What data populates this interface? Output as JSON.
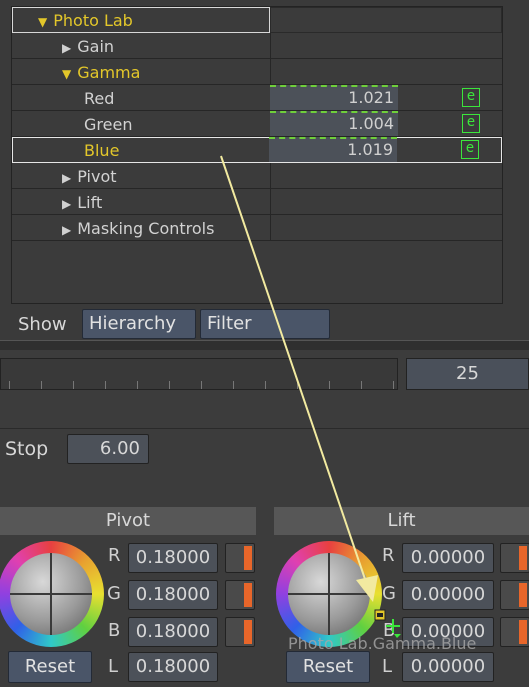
{
  "tree": {
    "rows": [
      {
        "label": "Photo Lab",
        "indent": 0,
        "expanded": true,
        "state": "header"
      },
      {
        "label": "Gain",
        "indent": 1,
        "expanded": false,
        "state": "normal"
      },
      {
        "label": "Gamma",
        "indent": 1,
        "expanded": true,
        "state": "active"
      },
      {
        "label": "Red",
        "indent": 2,
        "value": "1.021",
        "expr_icon": "e"
      },
      {
        "label": "Green",
        "indent": 2,
        "value": "1.004",
        "expr_icon": "e"
      },
      {
        "label": "Blue",
        "indent": 2,
        "value": "1.019",
        "expr_icon": "e",
        "selected": true
      },
      {
        "label": "Pivot",
        "indent": 1,
        "expanded": false
      },
      {
        "label": "Lift",
        "indent": 1,
        "expanded": false
      },
      {
        "label": "Masking Controls",
        "indent": 1,
        "expanded": false
      }
    ]
  },
  "show": {
    "label": "Show",
    "hierarchy": "Hierarchy",
    "filter": "Filter"
  },
  "timeline": {
    "frame": "25"
  },
  "stop": {
    "label": "Stop",
    "value": "6.00"
  },
  "pivot": {
    "title": "Pivot",
    "r_label": "R",
    "r": "0.18000",
    "g_label": "G",
    "g": "0.18000",
    "b_label": "B",
    "b": "0.18000",
    "l_label": "L",
    "l": "0.18000",
    "reset": "Reset"
  },
  "lift": {
    "title": "Lift",
    "r_label": "R",
    "r": "0.00000",
    "g_label": "G",
    "g": "0.00000",
    "b_label": "B",
    "b": "0.00000",
    "l_label": "L",
    "l": "0.00000",
    "reset": "Reset"
  },
  "drag_tooltip": "Photo Lab.Gamma.Blue",
  "colors": {
    "accent_yellow": "#e3c72a",
    "expr_green": "#3be63b",
    "swatch_orange": "#e8662a",
    "button_blue": "#4a5568"
  },
  "icons": {
    "expand": "triangle-right-icon",
    "collapse": "triangle-down-icon",
    "expression": "expression-e-icon",
    "drag_arrow": "drag-arrow-icon"
  }
}
